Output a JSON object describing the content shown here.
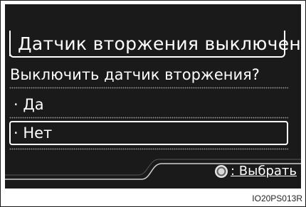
{
  "screen": {
    "title": "Датчик вторжения выключен.",
    "question": "Выключить датчик вторжения?",
    "options": [
      {
        "label": "· Да",
        "selected": false
      },
      {
        "label": "· Нет",
        "selected": true
      }
    ],
    "hint_label": ": Выбрать"
  },
  "caption": "IO20PS013R"
}
